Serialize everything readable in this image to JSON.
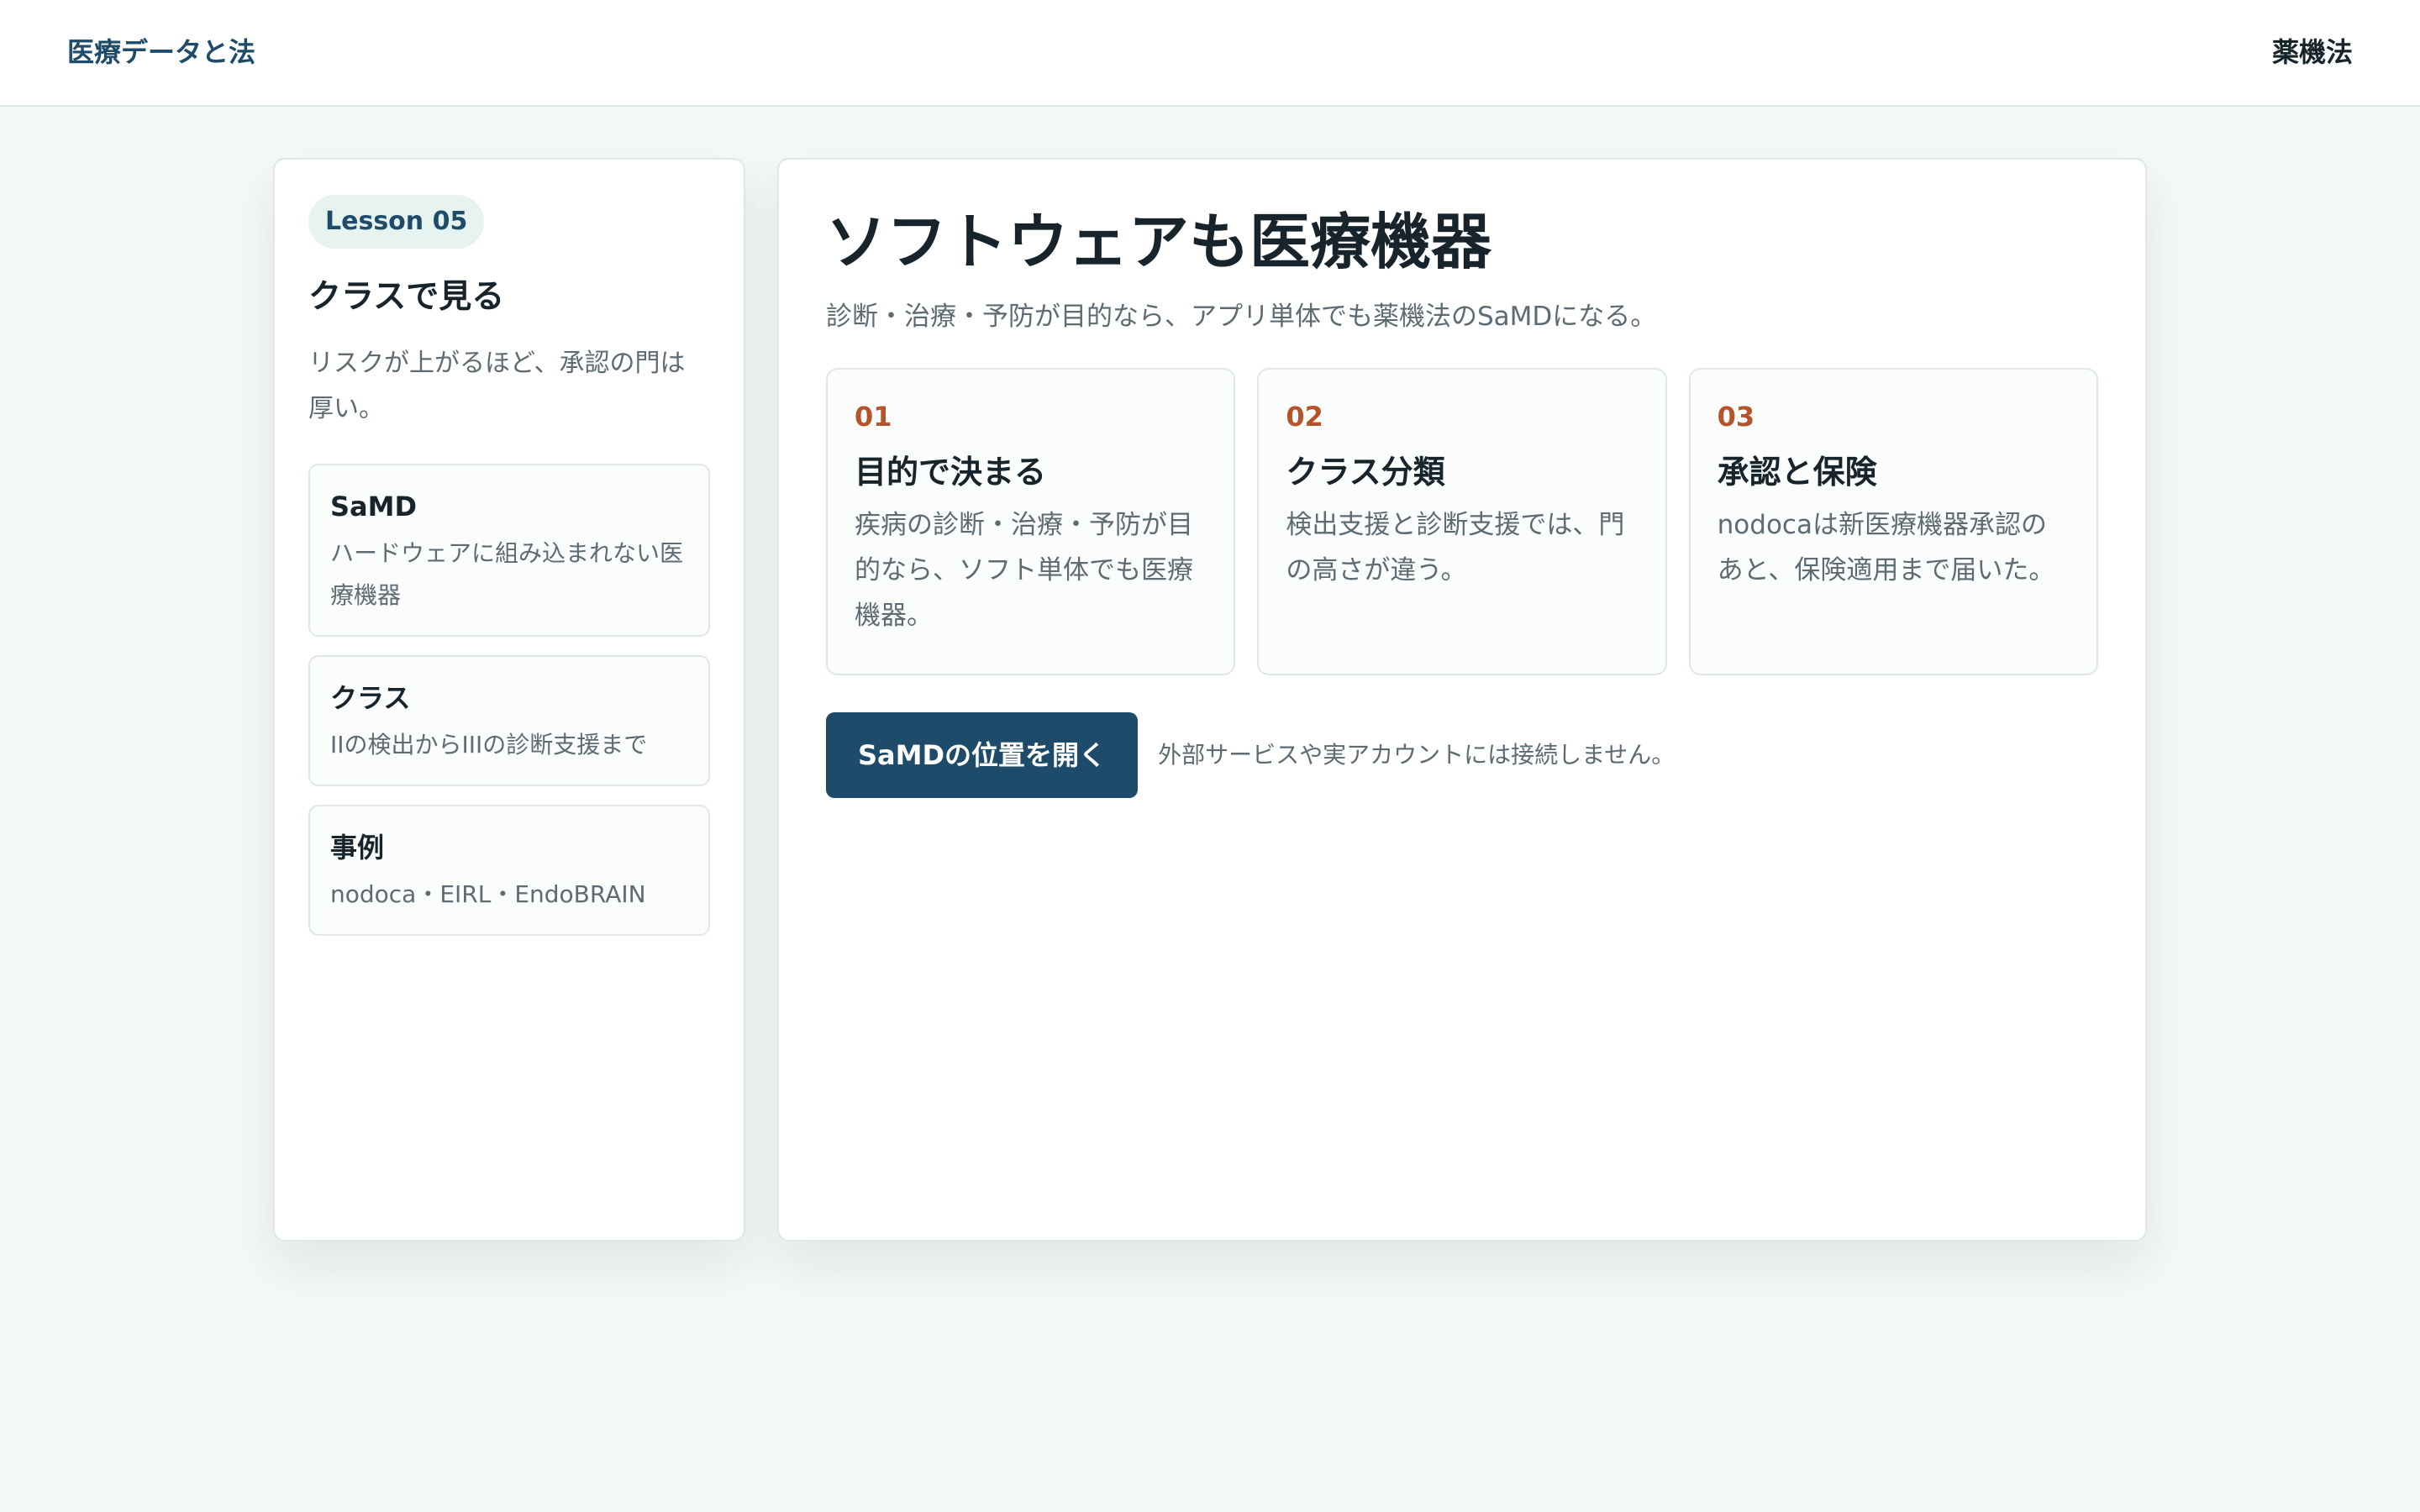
{
  "header": {
    "brand": "医療データと法",
    "nav_link": "薬機法"
  },
  "sidebar": {
    "badge": "Lesson 05",
    "title": "クラスで見る",
    "subtitle": "リスクが上がるほど、承認の門は厚い。",
    "items": [
      {
        "title": "SaMD",
        "text": "ハードウェアに組み込まれない医療機器"
      },
      {
        "title": "クラス",
        "text": "IIの検出からIIIの診断支援まで"
      },
      {
        "title": "事例",
        "text": "nodoca・EIRL・EndoBRAIN"
      }
    ]
  },
  "main": {
    "title": "ソフトウェアも医療機器",
    "subtitle": "診断・治療・予防が目的なら、アプリ単体でも薬機法のSaMDになる。",
    "cards": [
      {
        "num": "01",
        "title": "目的で決まる",
        "text": "疾病の診断・治療・予防が目的なら、ソフト単体でも医療機器。"
      },
      {
        "num": "02",
        "title": "クラス分類",
        "text": "検出支援と診断支援では、門の高さが違う。"
      },
      {
        "num": "03",
        "title": "承認と保険",
        "text": "nodocaは新医療機器承認のあと、保険適用まで届いた。"
      }
    ],
    "button_label": "SaMDの位置を開く",
    "note": "外部サービスや実アカウントには接続しません。"
  },
  "colors": {
    "accent": "#1e4b6a",
    "number": "#b5532a",
    "background": "#f4f8f7"
  }
}
